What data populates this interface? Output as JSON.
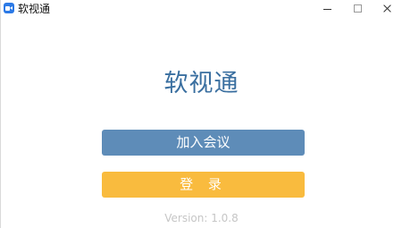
{
  "window": {
    "title": "软视通",
    "icon": "video-camera-icon",
    "controls": {
      "minimize_icon": "minimize-icon",
      "maximize_icon": "maximize-icon",
      "close_icon": "close-icon"
    }
  },
  "main": {
    "brand_title": "软视通",
    "join_meeting_label": "加入会议",
    "login_label": "登 录",
    "version_text": "Version: 1.0.8"
  },
  "colors": {
    "brand": "#3a6fa0",
    "join_button": "#5e8cb8",
    "login_button": "#f9bb3e",
    "version_text": "#c6c6c6"
  }
}
